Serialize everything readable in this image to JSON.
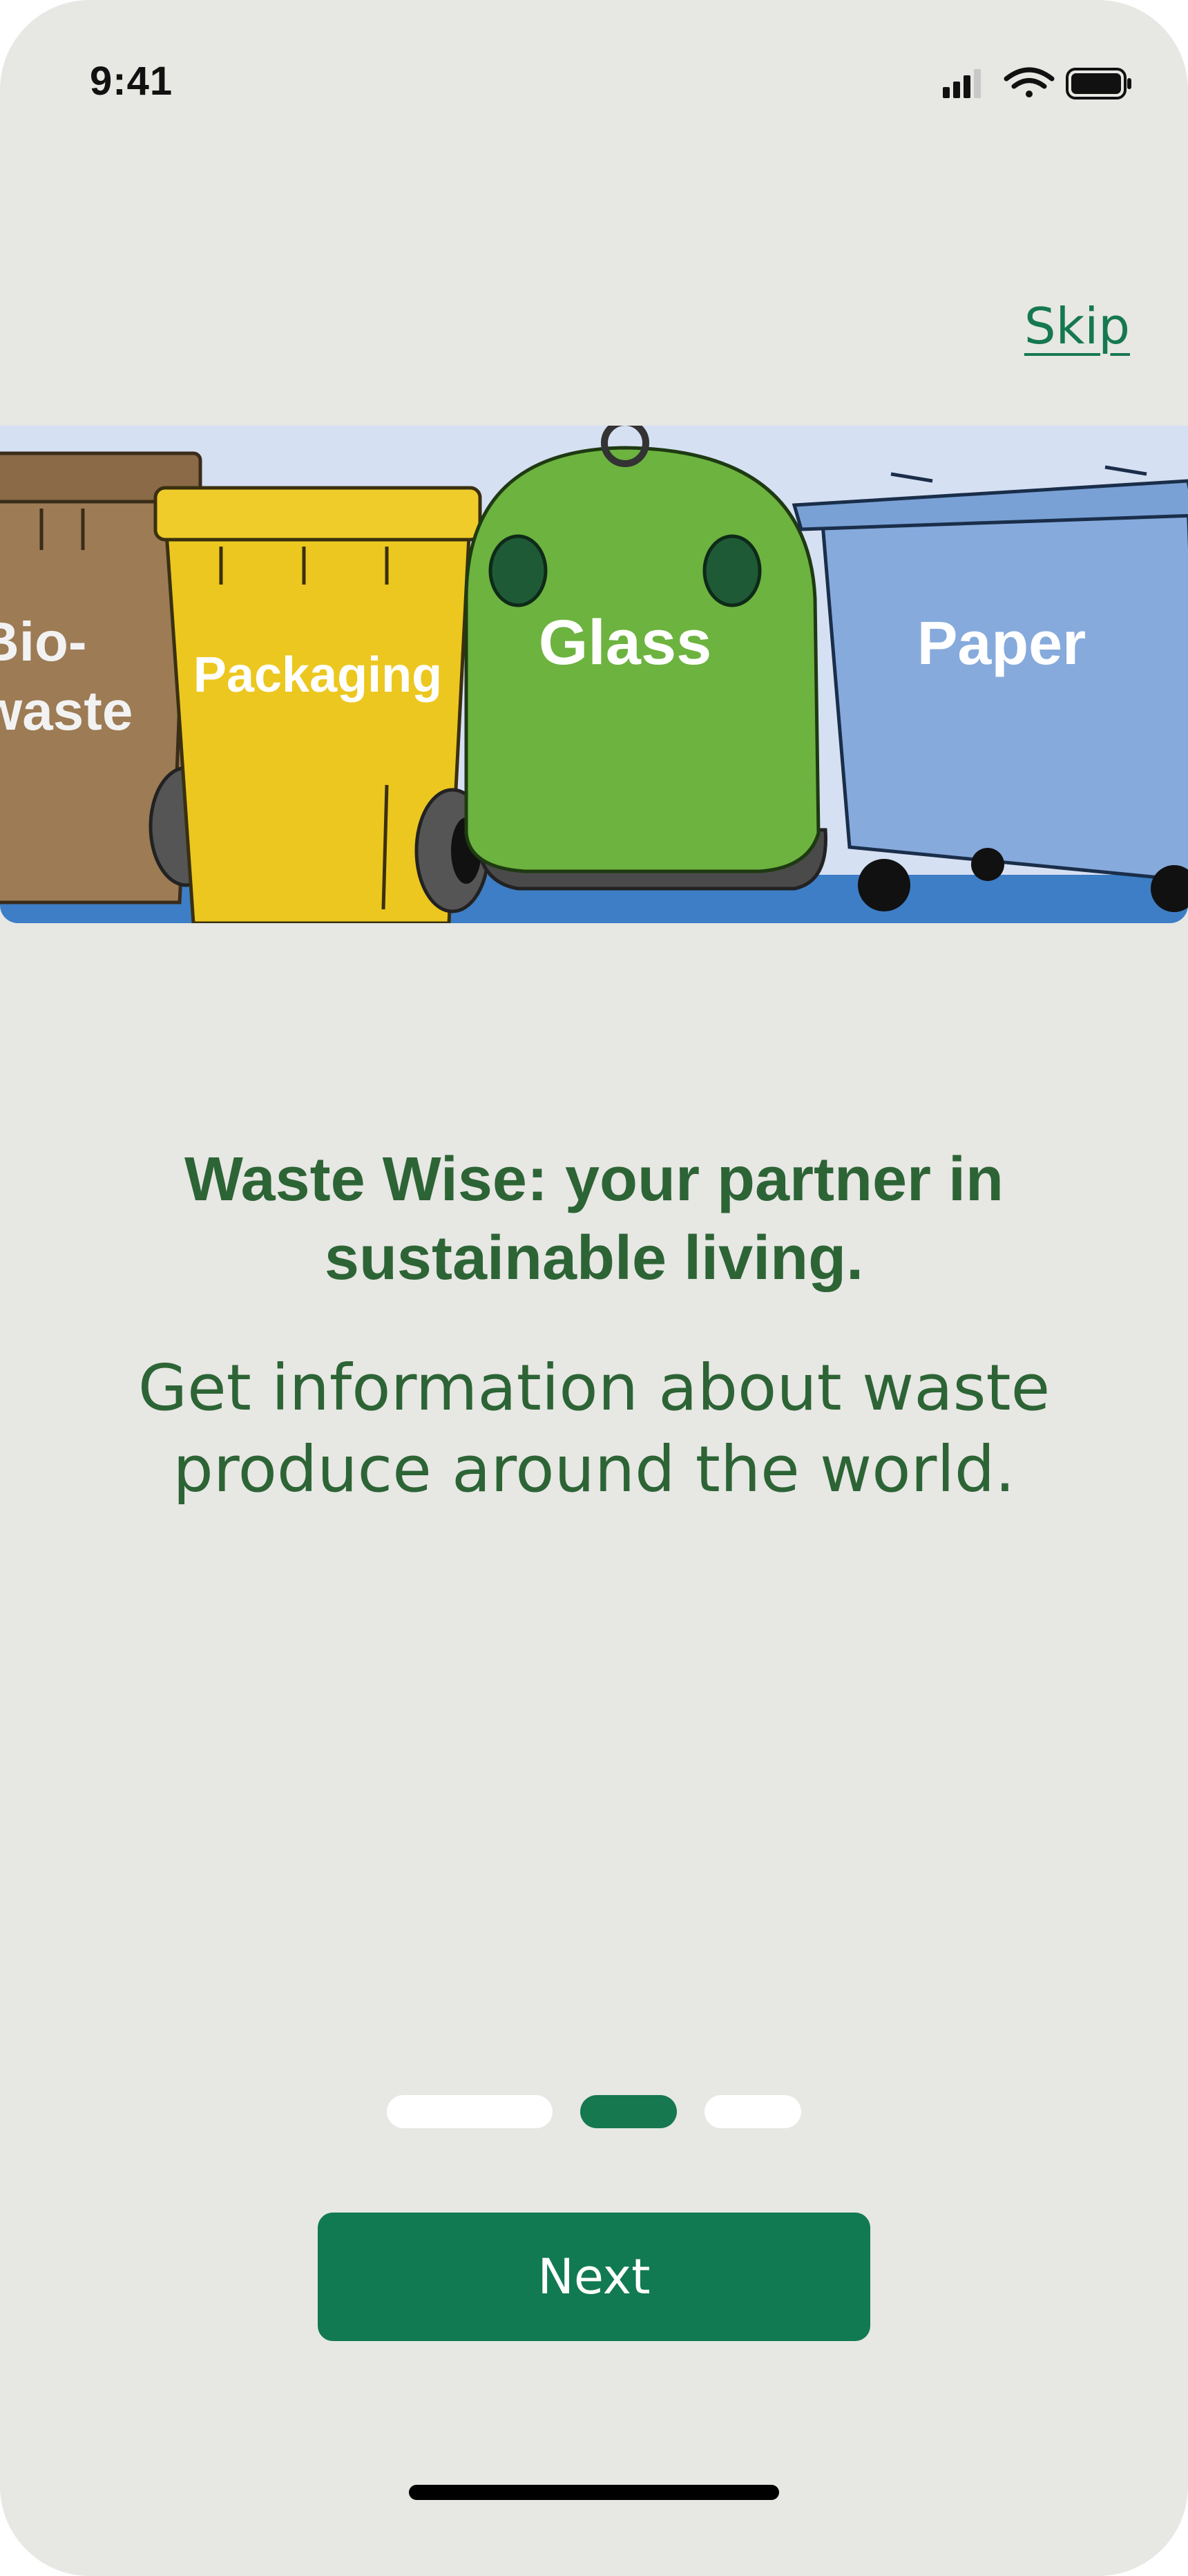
{
  "status_bar": {
    "time": "9:41",
    "icons": [
      "signal-icon",
      "wifi-icon",
      "battery-icon"
    ]
  },
  "skip_label": "Skip",
  "hero": {
    "description_icon": "waste-bins-illustration",
    "bins": [
      {
        "label_line1": "Bio-",
        "label_line2": "waste",
        "color": "#9c7b55"
      },
      {
        "label": "Packaging",
        "color": "#ecc71f"
      },
      {
        "label": "Glass",
        "color": "#6db33f"
      },
      {
        "label": "Paper",
        "color": "#86aadc"
      }
    ]
  },
  "headline_line1": "Waste Wise: your partner in",
  "headline_line2": "sustainable living.",
  "subtitle_line1": "Get information about waste",
  "subtitle_line2": "produce around the world.",
  "pagination": {
    "total": 3,
    "active": 2
  },
  "next_label": "Next",
  "colors": {
    "background": "#e7e7e4",
    "accent": "#117a52",
    "text": "#2d6435"
  }
}
